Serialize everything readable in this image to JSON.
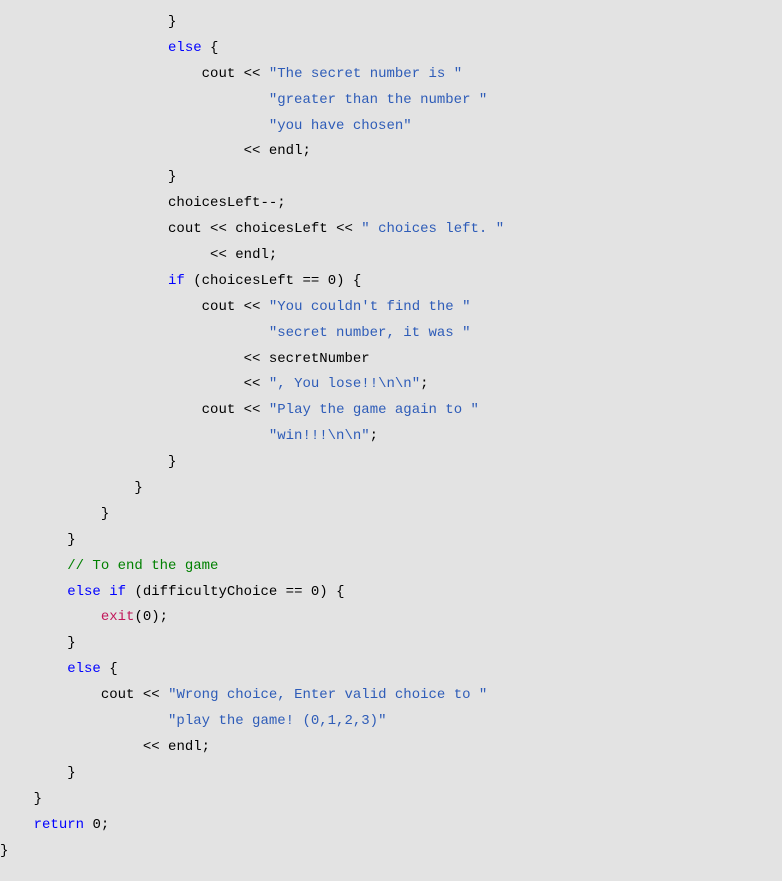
{
  "code": {
    "ind": {
      "i5": "                    ",
      "i6": "                        ",
      "i7": "                            ",
      "i8": "                                ",
      "i4": "                ",
      "i3": "            ",
      "i2": "        ",
      "i1": "    ",
      "i0": ""
    },
    "tokens": {
      "else": "else",
      "if": "if",
      "return": "return",
      "cout": "cout ",
      "endl": "endl",
      "lshift": "<< ",
      "lshift2": " << ",
      "open_brace": "{",
      "close_brace": "}",
      "semi": ";",
      "space": " ",
      "dec": "--",
      "eqeq": " == ",
      "zero": "0",
      "open_paren": "(",
      "close_paren": ")"
    },
    "ids": {
      "choicesLeft": "choicesLeft",
      "secretNumber": "secretNumber",
      "difficultyChoice": "difficultyChoice",
      "exit": "exit"
    },
    "strings": {
      "secret_greater_1": "\"The secret number is \"",
      "secret_greater_2": "\"greater than the number \"",
      "secret_greater_3": "\"you have chosen\"",
      "choices_left": "\" choices left. \"",
      "couldnt_find_1": "\"You couldn't find the \"",
      "couldnt_find_2": "\"secret number, it was \"",
      "you_lose": "\", You lose!!\\n\\n\"",
      "play_again_1": "\"Play the game again to \"",
      "play_again_2": "\"win!!!\\n\\n\"",
      "wrong_choice_1": "\"Wrong choice, Enter valid choice to \"",
      "wrong_choice_2": "\"play the game! (0,1,2,3)\""
    },
    "comments": {
      "end_game": "// To end the game"
    }
  }
}
